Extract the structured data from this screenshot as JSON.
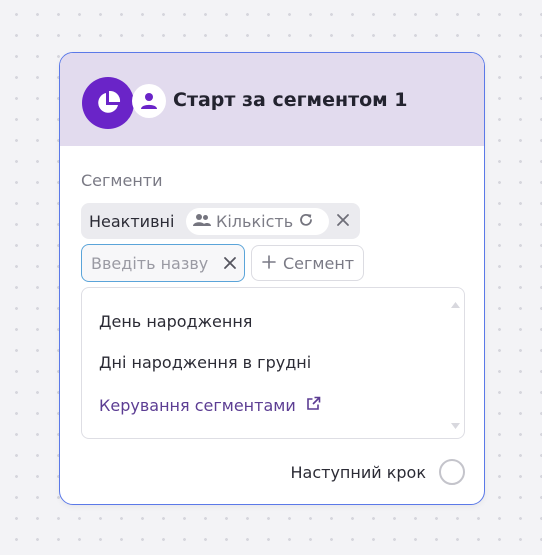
{
  "node": {
    "title": "Старт за сегментом 1",
    "section_label": "Сегменти",
    "segment": {
      "name": "Неактивні",
      "count_label": "Кількість"
    },
    "search": {
      "placeholder": "Введіть назву",
      "value": ""
    },
    "add_segment_label": "Сегмент",
    "dropdown": {
      "items": [
        "День народження",
        "Дні народження в грудні"
      ],
      "manage_link": "Керування сегментами"
    },
    "next_step_label": "Наступний крок"
  },
  "colors": {
    "accent": "#6a24c8",
    "header_bg": "#e2dbee",
    "card_border": "#5b79e8",
    "input_focus": "#5aa4d9",
    "link": "#5c3d93"
  },
  "icons": {
    "header_main": "pie-chart-icon",
    "header_sub": "person-icon",
    "count": "people-icon",
    "refresh": "refresh-icon",
    "close": "close-icon",
    "add": "plus-icon",
    "external": "external-link-icon"
  }
}
